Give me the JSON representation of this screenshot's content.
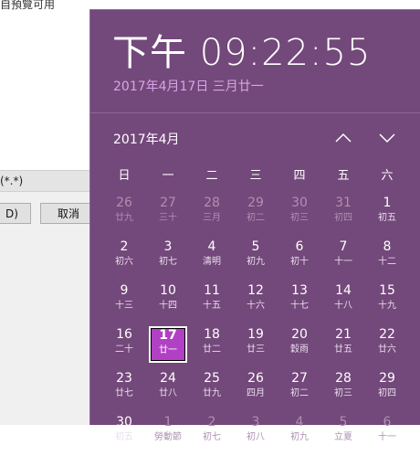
{
  "background_window": {
    "hint_text": "自預覽可用",
    "filter_text": "(*.*)",
    "open_button": "D)",
    "cancel_button": "取消"
  },
  "flyout": {
    "clock": "下午 09:22:55",
    "full_date": "2017年4月17日 三月廿一",
    "month_title": "2017年4月",
    "nav_up_icon": "chevron-up-icon",
    "nav_down_icon": "chevron-down-icon",
    "weekdays": [
      "日",
      "一",
      "二",
      "三",
      "四",
      "五",
      "六"
    ],
    "days": [
      {
        "n": "26",
        "l": "廿九",
        "out": true
      },
      {
        "n": "27",
        "l": "三十",
        "out": true
      },
      {
        "n": "28",
        "l": "三月",
        "out": true
      },
      {
        "n": "29",
        "l": "初二",
        "out": true
      },
      {
        "n": "30",
        "l": "初三",
        "out": true
      },
      {
        "n": "31",
        "l": "初四",
        "out": true
      },
      {
        "n": "1",
        "l": "初五"
      },
      {
        "n": "2",
        "l": "初六"
      },
      {
        "n": "3",
        "l": "初七"
      },
      {
        "n": "4",
        "l": "清明"
      },
      {
        "n": "5",
        "l": "初九"
      },
      {
        "n": "6",
        "l": "初十"
      },
      {
        "n": "7",
        "l": "十一"
      },
      {
        "n": "8",
        "l": "十二"
      },
      {
        "n": "9",
        "l": "十三"
      },
      {
        "n": "10",
        "l": "十四"
      },
      {
        "n": "11",
        "l": "十五"
      },
      {
        "n": "12",
        "l": "十六"
      },
      {
        "n": "13",
        "l": "十七"
      },
      {
        "n": "14",
        "l": "十八"
      },
      {
        "n": "15",
        "l": "十九"
      },
      {
        "n": "16",
        "l": "二十"
      },
      {
        "n": "17",
        "l": "廿一",
        "today": true
      },
      {
        "n": "18",
        "l": "廿二"
      },
      {
        "n": "19",
        "l": "廿三"
      },
      {
        "n": "20",
        "l": "穀雨"
      },
      {
        "n": "21",
        "l": "廿五"
      },
      {
        "n": "22",
        "l": "廿六"
      },
      {
        "n": "23",
        "l": "廿七"
      },
      {
        "n": "24",
        "l": "廿八"
      },
      {
        "n": "25",
        "l": "廿九"
      },
      {
        "n": "26",
        "l": "四月"
      },
      {
        "n": "27",
        "l": "初二"
      },
      {
        "n": "28",
        "l": "初三"
      },
      {
        "n": "29",
        "l": "初四"
      },
      {
        "n": "30",
        "l": "初五"
      },
      {
        "n": "1",
        "l": "勞動節",
        "out": true
      },
      {
        "n": "2",
        "l": "初七",
        "out": true
      },
      {
        "n": "3",
        "l": "初八",
        "out": true
      },
      {
        "n": "4",
        "l": "初九",
        "out": true
      },
      {
        "n": "5",
        "l": "立夏",
        "out": true
      },
      {
        "n": "6",
        "l": "十一",
        "out": true
      }
    ]
  }
}
